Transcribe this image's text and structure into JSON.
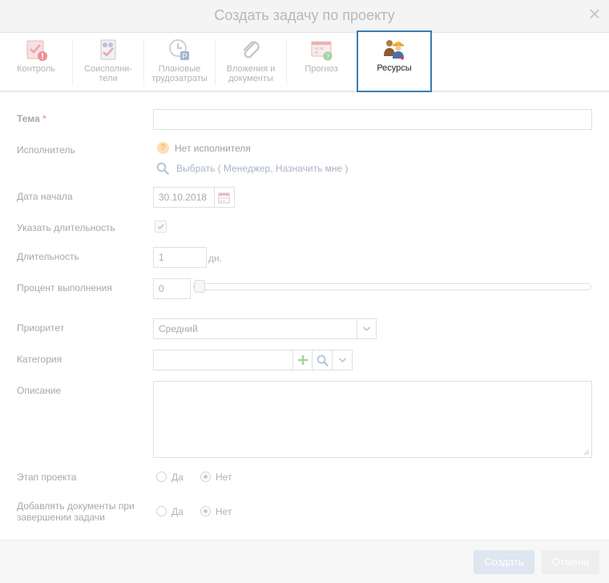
{
  "dialog": {
    "title": "Создать задачу по проекту",
    "close_symbol": "×"
  },
  "tabs": [
    {
      "label": "Контроль",
      "icon": "control-icon"
    },
    {
      "label": "Соисполни-тели",
      "icon": "coexecutors-icon"
    },
    {
      "label": "Плановые трудозатраты",
      "icon": "planned-labor-icon"
    },
    {
      "label": "Вложения и документы",
      "icon": "attachment-icon"
    },
    {
      "label": "Прогноз",
      "icon": "forecast-icon"
    },
    {
      "label": "Ресурсы",
      "icon": "resources-icon",
      "active": true
    }
  ],
  "form": {
    "subject": {
      "label": "Тема",
      "required_mark": "*",
      "value": ""
    },
    "executor": {
      "label": "Исполнитель",
      "status": "Нет исполнителя",
      "status_icon_symbol": "?",
      "choose_text": "Выбрать ( Менеджер, Назначить мне )"
    },
    "start_date": {
      "label": "Дата начала",
      "value": "30.10.2018"
    },
    "set_duration": {
      "label": "Указать длительность",
      "checked": true
    },
    "duration": {
      "label": "Длительность",
      "value": "1",
      "unit": "дн."
    },
    "percent": {
      "label": "Процент выполнения",
      "value": "0",
      "slider_fraction": 0
    },
    "priority": {
      "label": "Приоритет",
      "value": "Средний"
    },
    "category": {
      "label": "Категория",
      "value": ""
    },
    "description": {
      "label": "Описание",
      "value": ""
    },
    "project_stage": {
      "label": "Этап проекта",
      "options": [
        "Да",
        "Нет"
      ],
      "selected": "Нет"
    },
    "add_documents": {
      "label_line1": "Добавлять документы при",
      "label_line2": "завершении задачи",
      "options": [
        "Да",
        "Нет"
      ],
      "selected": "Нет"
    }
  },
  "footer": {
    "create_label": "Создать",
    "cancel_label": "Отмена"
  },
  "colors": {
    "active_tab_border": "#3a7db4",
    "create_button": "#dde6f1",
    "cancel_button": "#eeeeee"
  }
}
